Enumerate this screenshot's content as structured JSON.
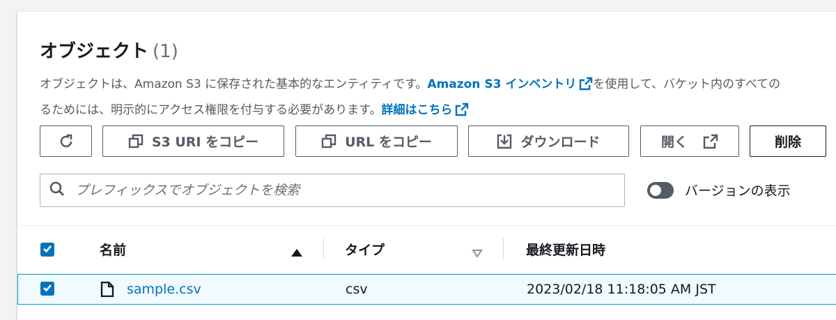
{
  "header": {
    "title": "オブジェクト",
    "count": "(1)"
  },
  "description": {
    "line1_pre": "オブジェクトは、Amazon S3 に保存された基本的なエンティティです。",
    "line1_link": "Amazon S3 インベントリ",
    "line1_post": "を使用して、バケット内のすべての",
    "line2_pre": "るためには、明示的にアクセス権限を付与する必要があります。",
    "line2_link": "詳細はこちら"
  },
  "toolbar": {
    "refresh_label": "",
    "copy_s3_uri_label": "S3 URI をコピー",
    "copy_url_label": "URL をコピー",
    "download_label": "ダウンロード",
    "open_label": "開く",
    "delete_label": "削除"
  },
  "search": {
    "placeholder": "プレフィックスでオブジェクトを検索"
  },
  "versions_toggle": {
    "label": "バージョンの表示",
    "on": false
  },
  "table": {
    "columns": [
      "名前",
      "タイプ",
      "最終更新日時"
    ],
    "rows": [
      {
        "name": "sample.csv",
        "type": "csv",
        "last_modified": "2023/02/18 11:18:05 AM JST",
        "selected": true
      }
    ]
  },
  "colors": {
    "link": "#0073bb",
    "checkbox": "#0073bb",
    "selected_row_border": "#00a1c9",
    "selected_row_bg": "#f1faff"
  },
  "icons": [
    "refresh-icon",
    "copy-icon",
    "download-icon",
    "external-link-icon",
    "search-icon",
    "sort-asc-icon",
    "sort-desc-icon",
    "file-icon",
    "check-icon"
  ]
}
